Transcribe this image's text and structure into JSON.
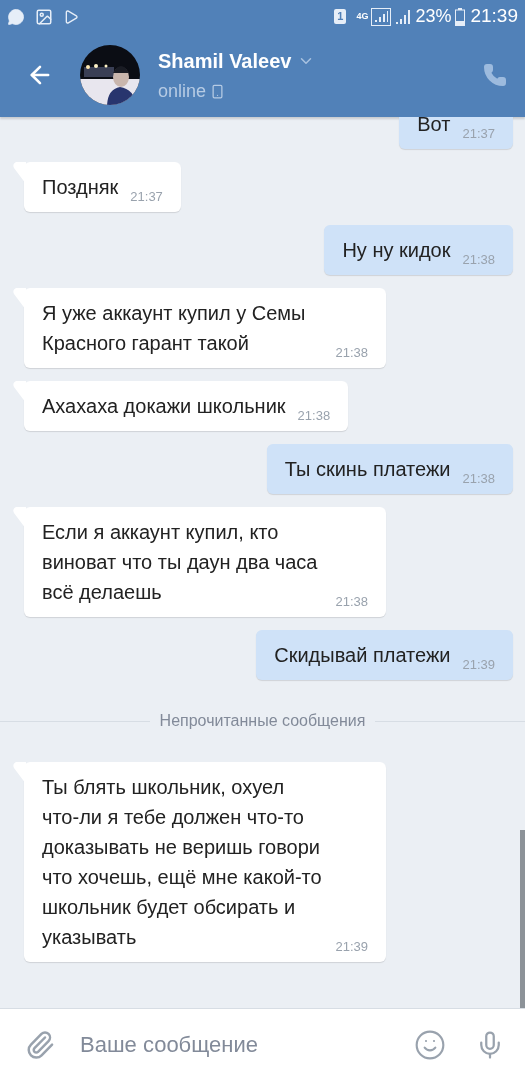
{
  "status_bar": {
    "sim": "1",
    "network": "4G",
    "battery": "23%",
    "time": "21:39"
  },
  "header": {
    "name": "Shamil Valeev",
    "status": "online"
  },
  "messages": [
    {
      "kind": "out",
      "text": "Вот",
      "time": "21:37"
    },
    {
      "kind": "in",
      "text": "Поздняк",
      "time": "21:37"
    },
    {
      "kind": "out",
      "text": "Ну ну кидок",
      "time": "21:38"
    },
    {
      "kind": "in",
      "text": "Я уже аккаунт купил у Семы Красного гарант такой",
      "time": "21:38"
    },
    {
      "kind": "in",
      "text": "Ахахаха докажи школьник",
      "time": "21:38"
    },
    {
      "kind": "out",
      "text": "Ты скинь платежи",
      "time": "21:38"
    },
    {
      "kind": "in",
      "text": "Если я аккаунт купил, кто виноват что ты даун два часа всё делаешь",
      "time": "21:38"
    },
    {
      "kind": "out",
      "text": "Скидывай платежи",
      "time": "21:39"
    },
    {
      "kind": "divider",
      "text": "Непрочитанные сообщения"
    },
    {
      "kind": "in",
      "text": "Ты блять школьник, охуел что-ли я тебе должен что-то доказывать не веришь говори что хочешь, ещё мне какой-то школьник будет обсирать и указывать",
      "time": "21:39"
    }
  ],
  "composer": {
    "placeholder": "Ваше сообщение"
  }
}
